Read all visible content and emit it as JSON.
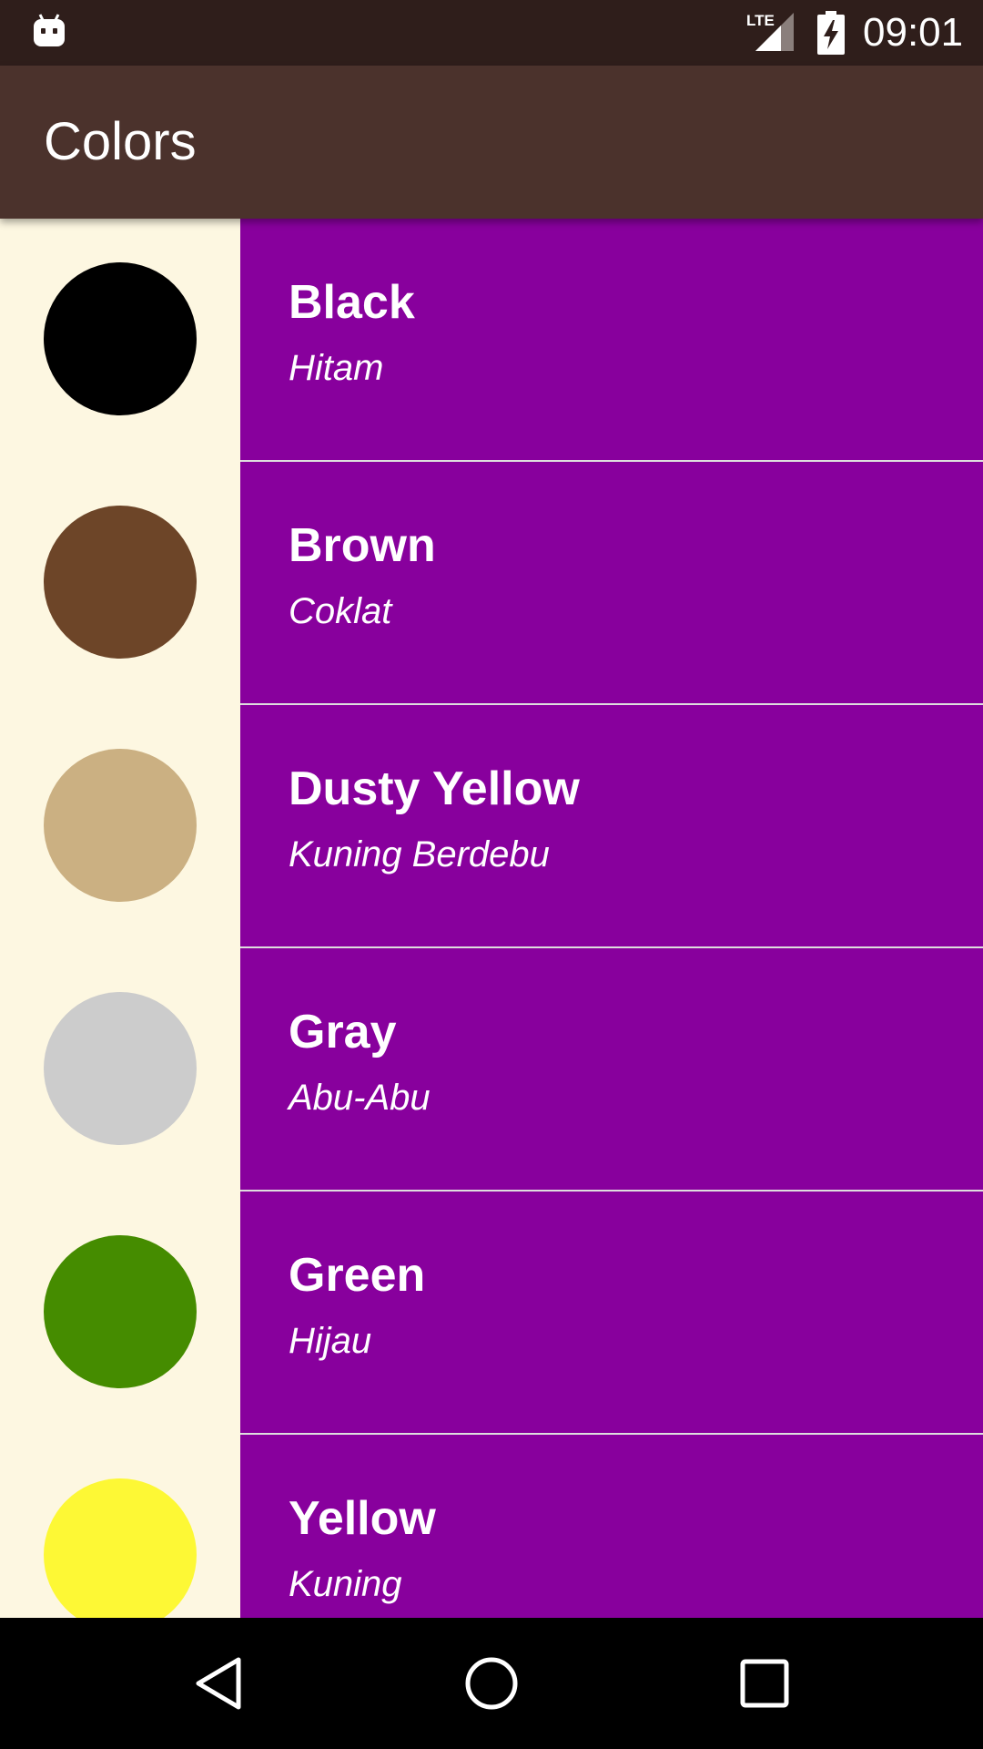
{
  "status_bar": {
    "time": "09:01",
    "network": "LTE",
    "icons": [
      "android-notification-icon",
      "lte-signal-icon",
      "battery-charging-icon"
    ]
  },
  "app_bar": {
    "title": "Colors"
  },
  "colors": [
    {
      "english": "Black",
      "translation": "Hitam",
      "swatch": "#000000"
    },
    {
      "english": "Brown",
      "translation": "Coklat",
      "swatch": "#6d4528"
    },
    {
      "english": "Dusty Yellow",
      "translation": "Kuning Berdebu",
      "swatch": "#cbb082"
    },
    {
      "english": "Gray",
      "translation": "Abu-Abu",
      "swatch": "#cccccc"
    },
    {
      "english": "Green",
      "translation": "Hijau",
      "swatch": "#458c00"
    },
    {
      "english": "Yellow",
      "translation": "Kuning",
      "swatch": "#fdf835"
    }
  ],
  "theme": {
    "status_bar": "#2f1e1b",
    "app_bar": "#4b322c",
    "list_item_text_background": "#88009d",
    "swatch_background": "#fdf7e1",
    "nav_bar": "#000000"
  },
  "nav_bar": {
    "buttons": [
      "back-icon",
      "home-icon",
      "recents-icon"
    ]
  }
}
